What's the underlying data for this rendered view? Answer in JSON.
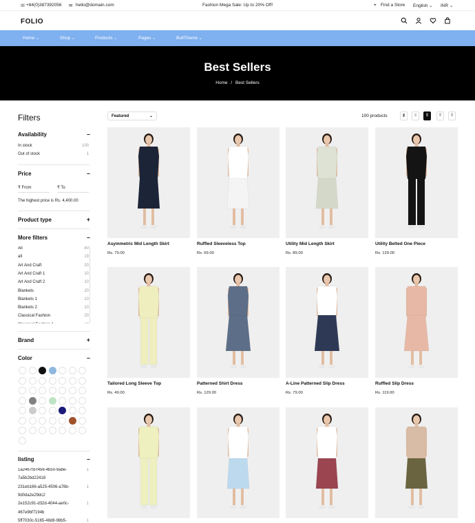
{
  "topbar": {
    "phone": "+84(0)387392056",
    "email": "hello@domain.com",
    "promo": "Fashion Mega Sale: Up to 20% Off!",
    "store": "Find a Store",
    "language": "English",
    "currency": "INR"
  },
  "header": {
    "logo": "FOLIO"
  },
  "nav": {
    "items": [
      "Home",
      "Shop",
      "Products",
      "Pages",
      "BullTheme"
    ]
  },
  "hero": {
    "title": "Best Sellers",
    "breadcrumb_home": "Home",
    "breadcrumb_sep": "/",
    "breadcrumb_current": "Best Sellers"
  },
  "filters": {
    "title": "Filters",
    "availability": {
      "title": "Availability",
      "toggle": "–",
      "items": [
        {
          "label": "In stock",
          "count": "100"
        },
        {
          "label": "Out of stock",
          "count": "1"
        }
      ]
    },
    "price": {
      "title": "Price",
      "toggle": "–",
      "from": "₹ From",
      "to": "₹ To",
      "note": "The highest price is Rs. 4,400.00"
    },
    "product_type": {
      "title": "Product type",
      "toggle": "+"
    },
    "more": {
      "title": "More filters",
      "toggle": "–",
      "items": [
        {
          "label": "All",
          "count": "80"
        },
        {
          "label": "all",
          "count": "19"
        },
        {
          "label": "Art And Craft",
          "count": "20"
        },
        {
          "label": "Art And Craft 1",
          "count": "10"
        },
        {
          "label": "Art And Craft 2",
          "count": "10"
        },
        {
          "label": "Blankets",
          "count": "20"
        },
        {
          "label": "Blankets 1",
          "count": "10"
        },
        {
          "label": "Blankets 2",
          "count": "10"
        },
        {
          "label": "Classical Fashion",
          "count": "20"
        },
        {
          "label": "Classical Fashion 1",
          "count": "10"
        }
      ]
    },
    "brand": {
      "title": "Brand",
      "toggle": "+"
    },
    "color": {
      "title": "Color",
      "toggle": "–",
      "filled": {
        "c": [
          "#111111",
          "#8fb8de",
          "#808080",
          "#bfe3c4",
          "#cccccc",
          "#1a1a7a",
          "#a0522d"
        ]
      }
    },
    "listing": {
      "title": "listing",
      "toggle": "–",
      "items": [
        {
          "label": "1a2467fd-f456-4b50-9abe-",
          "count": "1"
        },
        {
          "label": "7a5b2bd22418",
          "count": ""
        },
        {
          "label": "231eb166-a525-4506-a78b-",
          "count": "1"
        },
        {
          "label": "9d0da2e29dc2",
          "count": ""
        },
        {
          "label": "2e152c91-d32d-4044-ae0c-",
          "count": "1"
        },
        {
          "label": "467e9bf7194b",
          "count": ""
        },
        {
          "label": "5ff7030c-5165-48d8-98b5-",
          "count": "1"
        }
      ]
    }
  },
  "toolbar": {
    "sort": "Featured",
    "count": "100 products"
  },
  "products": [
    {
      "name": "Asymmetric Mid Length Skirt",
      "price": "Rs. 79.00",
      "top": "#1c2438",
      "bottom": "#1c2438",
      "style": "skirt"
    },
    {
      "name": "Ruffled Sleeveless Top",
      "price": "Rs. 69.00",
      "top": "#ffffff",
      "bottom": "#f4f4f4",
      "style": "skirt"
    },
    {
      "name": "Utility Mid Length Skirt",
      "price": "Rs. 89.00",
      "top": "#dde2d4",
      "bottom": "#d3d8c8",
      "style": "skirt"
    },
    {
      "name": "Utility Belted One Piece",
      "price": "Rs. 129.00",
      "top": "#141414",
      "bottom": "#141414",
      "style": "pants"
    },
    {
      "name": "Tailored Long Sleeve Top",
      "price": "Rs. 49.00",
      "top": "#efeebf",
      "bottom": "#efeebf",
      "style": "pants"
    },
    {
      "name": "Patterned Shirt Dress",
      "price": "Rs. 129.00",
      "top": "#5d6f88",
      "bottom": "#5d6f88",
      "style": "dress"
    },
    {
      "name": "A-Line Patterned Slip Dress",
      "price": "Rs. 79.00",
      "top": "#ffffff",
      "bottom": "#2e3a55",
      "style": "dress"
    },
    {
      "name": "Ruffled Slip Dress",
      "price": "Rs. 119.00",
      "top": "#e8b8a6",
      "bottom": "#e8b8a6",
      "style": "dress"
    },
    {
      "name": "",
      "price": "",
      "top": "#eef0bf",
      "bottom": "#eef0bf",
      "style": "pants"
    },
    {
      "name": "",
      "price": "",
      "top": "#ffffff",
      "bottom": "#bcd9ee",
      "style": "skirt"
    },
    {
      "name": "",
      "price": "",
      "top": "#ffffff",
      "bottom": "#9a4550",
      "style": "skirt"
    },
    {
      "name": "",
      "price": "",
      "top": "#d8bca6",
      "bottom": "#6b6440",
      "style": "skirt"
    }
  ]
}
